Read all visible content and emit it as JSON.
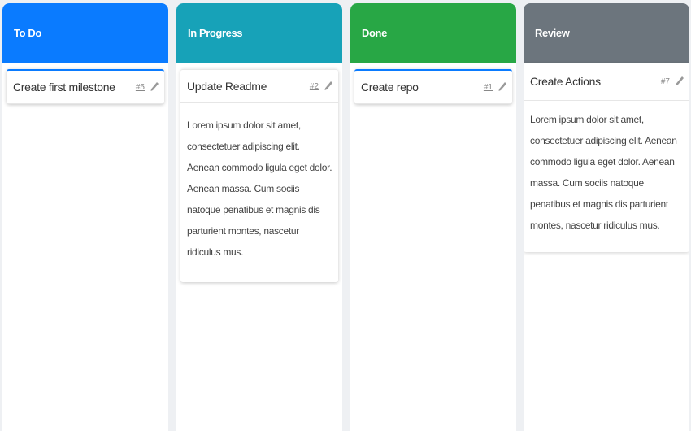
{
  "columns": [
    {
      "title": "To Do",
      "cards": [
        {
          "title": "Create first milestone",
          "number": "#5",
          "body": ""
        }
      ]
    },
    {
      "title": "In Progress",
      "cards": [
        {
          "title": "Update Readme",
          "number": "#2",
          "body": "Lorem ipsum dolor sit amet, consectetuer adipiscing elit. Aenean commodo ligula eget dolor. Aenean massa. Cum sociis natoque penatibus et magnis dis parturient montes, nascetur ridiculus mus."
        }
      ]
    },
    {
      "title": "Done",
      "cards": [
        {
          "title": "Create repo",
          "number": "#1",
          "body": ""
        }
      ]
    },
    {
      "title": "Review",
      "cards": [
        {
          "title": "Create Actions",
          "number": "#7",
          "body": "Lorem ipsum dolor sit amet, consectetuer adipiscing elit. Aenean commodo ligula eget dolor. Aenean massa. Cum sociis natoque penatibus et magnis dis parturient montes, nascetur ridiculus mus."
        }
      ]
    }
  ],
  "colors": {
    "todo": "#0a7bff",
    "in_progress": "#17a2b8",
    "done": "#28a745",
    "review": "#6c757d"
  },
  "icons": {
    "edit": "pencil-icon"
  }
}
